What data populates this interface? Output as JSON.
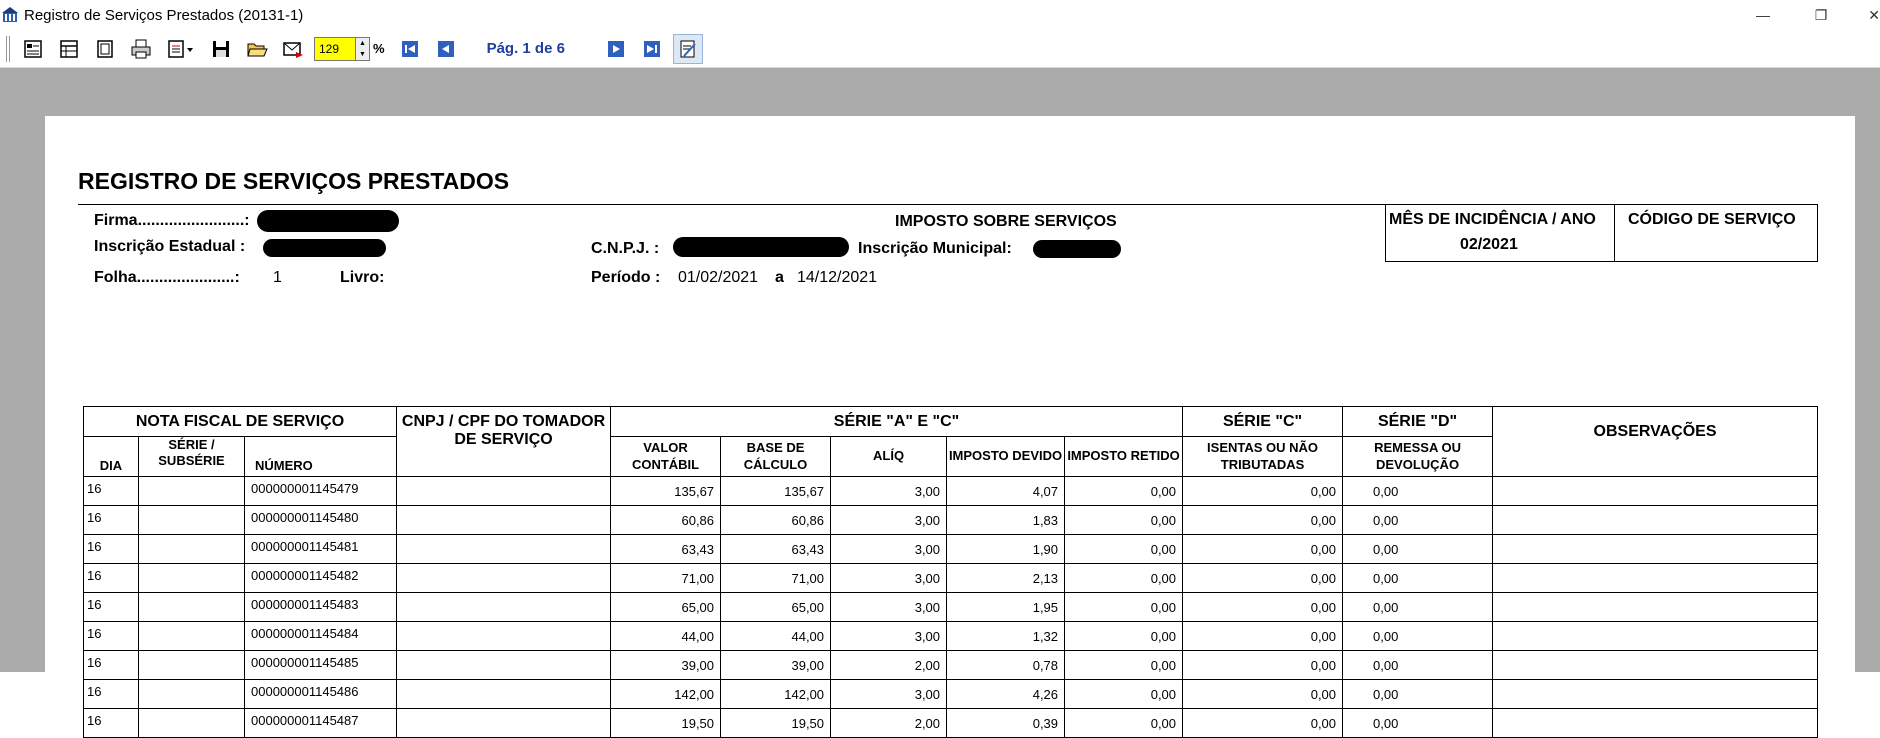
{
  "window": {
    "title": "Registro de Serviços Prestados (20131-1)",
    "minimize": "—",
    "maximize": "❐",
    "close": "✕"
  },
  "toolbar": {
    "zoom_value": "129",
    "zoom_unit": "%",
    "page_label": "Pág. 1 de 6"
  },
  "report": {
    "title": "REGISTRO DE SERVIÇOS PRESTADOS",
    "firma_label": "Firma........................:",
    "inscricao_estadual_label": "Inscrição Estadual :",
    "folha_label": "Folha......................:",
    "folha_value": "1",
    "livro_label": "Livro:",
    "imposto_label": "IMPOSTO SOBRE SERVIÇOS",
    "cnpj_label": "C.N.P.J. :",
    "inscricao_municipal_label": "Inscrição Municipal:",
    "periodo_label": "Período :",
    "periodo_start": "01/02/2021",
    "periodo_sep": "a",
    "periodo_end": "14/12/2021",
    "mes_label": "MÊS DE INCIDÊNCIA / ANO",
    "mes_value": "02/2021",
    "codigo_label": "CÓDIGO DE SERVIÇO"
  },
  "table": {
    "groups": {
      "nota_fiscal": "NOTA FISCAL DE SERVIÇO",
      "cnpj_cpf": "CNPJ / CPF  DO TOMADOR DE SERVIÇO",
      "serie_ac": "SÉRIE  \"A\"  E  \"C\"",
      "serie_c": "SÉRIE  \"C\"",
      "serie_d": "SÉRIE  \"D\"",
      "observacoes": "OBSERVAÇÕES"
    },
    "columns": {
      "dia": "DIA",
      "serie_subserie": "SÉRIE / SUBSÉRIE",
      "numero": "NÚMERO",
      "valor_contabil": "VALOR CONTÁBIL",
      "base_calculo": "BASE DE CÁLCULO",
      "aliq": "ALÍQ",
      "imposto_devido": "IMPOSTO DEVIDO",
      "imposto_retido": "IMPOSTO RETIDO",
      "isentas": "ISENTAS OU NÃO TRIBUTADAS",
      "remessa": "REMESSA OU DEVOLUÇÃO"
    },
    "rows": [
      {
        "dia": "16",
        "serie": "",
        "numero": "000000001145479",
        "cnpj": "",
        "valor": "135,67",
        "base": "135,67",
        "aliq": "3,00",
        "devido": "4,07",
        "retido": "0,00",
        "isentas": "0,00",
        "remessa": "0,00",
        "obs": ""
      },
      {
        "dia": "16",
        "serie": "",
        "numero": "000000001145480",
        "cnpj": "",
        "valor": "60,86",
        "base": "60,86",
        "aliq": "3,00",
        "devido": "1,83",
        "retido": "0,00",
        "isentas": "0,00",
        "remessa": "0,00",
        "obs": ""
      },
      {
        "dia": "16",
        "serie": "",
        "numero": "000000001145481",
        "cnpj": "",
        "valor": "63,43",
        "base": "63,43",
        "aliq": "3,00",
        "devido": "1,90",
        "retido": "0,00",
        "isentas": "0,00",
        "remessa": "0,00",
        "obs": ""
      },
      {
        "dia": "16",
        "serie": "",
        "numero": "000000001145482",
        "cnpj": "",
        "valor": "71,00",
        "base": "71,00",
        "aliq": "3,00",
        "devido": "2,13",
        "retido": "0,00",
        "isentas": "0,00",
        "remessa": "0,00",
        "obs": ""
      },
      {
        "dia": "16",
        "serie": "",
        "numero": "000000001145483",
        "cnpj": "",
        "valor": "65,00",
        "base": "65,00",
        "aliq": "3,00",
        "devido": "1,95",
        "retido": "0,00",
        "isentas": "0,00",
        "remessa": "0,00",
        "obs": ""
      },
      {
        "dia": "16",
        "serie": "",
        "numero": "000000001145484",
        "cnpj": "",
        "valor": "44,00",
        "base": "44,00",
        "aliq": "3,00",
        "devido": "1,32",
        "retido": "0,00",
        "isentas": "0,00",
        "remessa": "0,00",
        "obs": ""
      },
      {
        "dia": "16",
        "serie": "",
        "numero": "000000001145485",
        "cnpj": "",
        "valor": "39,00",
        "base": "39,00",
        "aliq": "2,00",
        "devido": "0,78",
        "retido": "0,00",
        "isentas": "0,00",
        "remessa": "0,00",
        "obs": ""
      },
      {
        "dia": "16",
        "serie": "",
        "numero": "000000001145486",
        "cnpj": "",
        "valor": "142,00",
        "base": "142,00",
        "aliq": "3,00",
        "devido": "4,26",
        "retido": "0,00",
        "isentas": "0,00",
        "remessa": "0,00",
        "obs": ""
      },
      {
        "dia": "16",
        "serie": "",
        "numero": "000000001145487",
        "cnpj": "",
        "valor": "19,50",
        "base": "19,50",
        "aliq": "2,00",
        "devido": "0,39",
        "retido": "0,00",
        "isentas": "0,00",
        "remessa": "0,00",
        "obs": ""
      }
    ]
  }
}
